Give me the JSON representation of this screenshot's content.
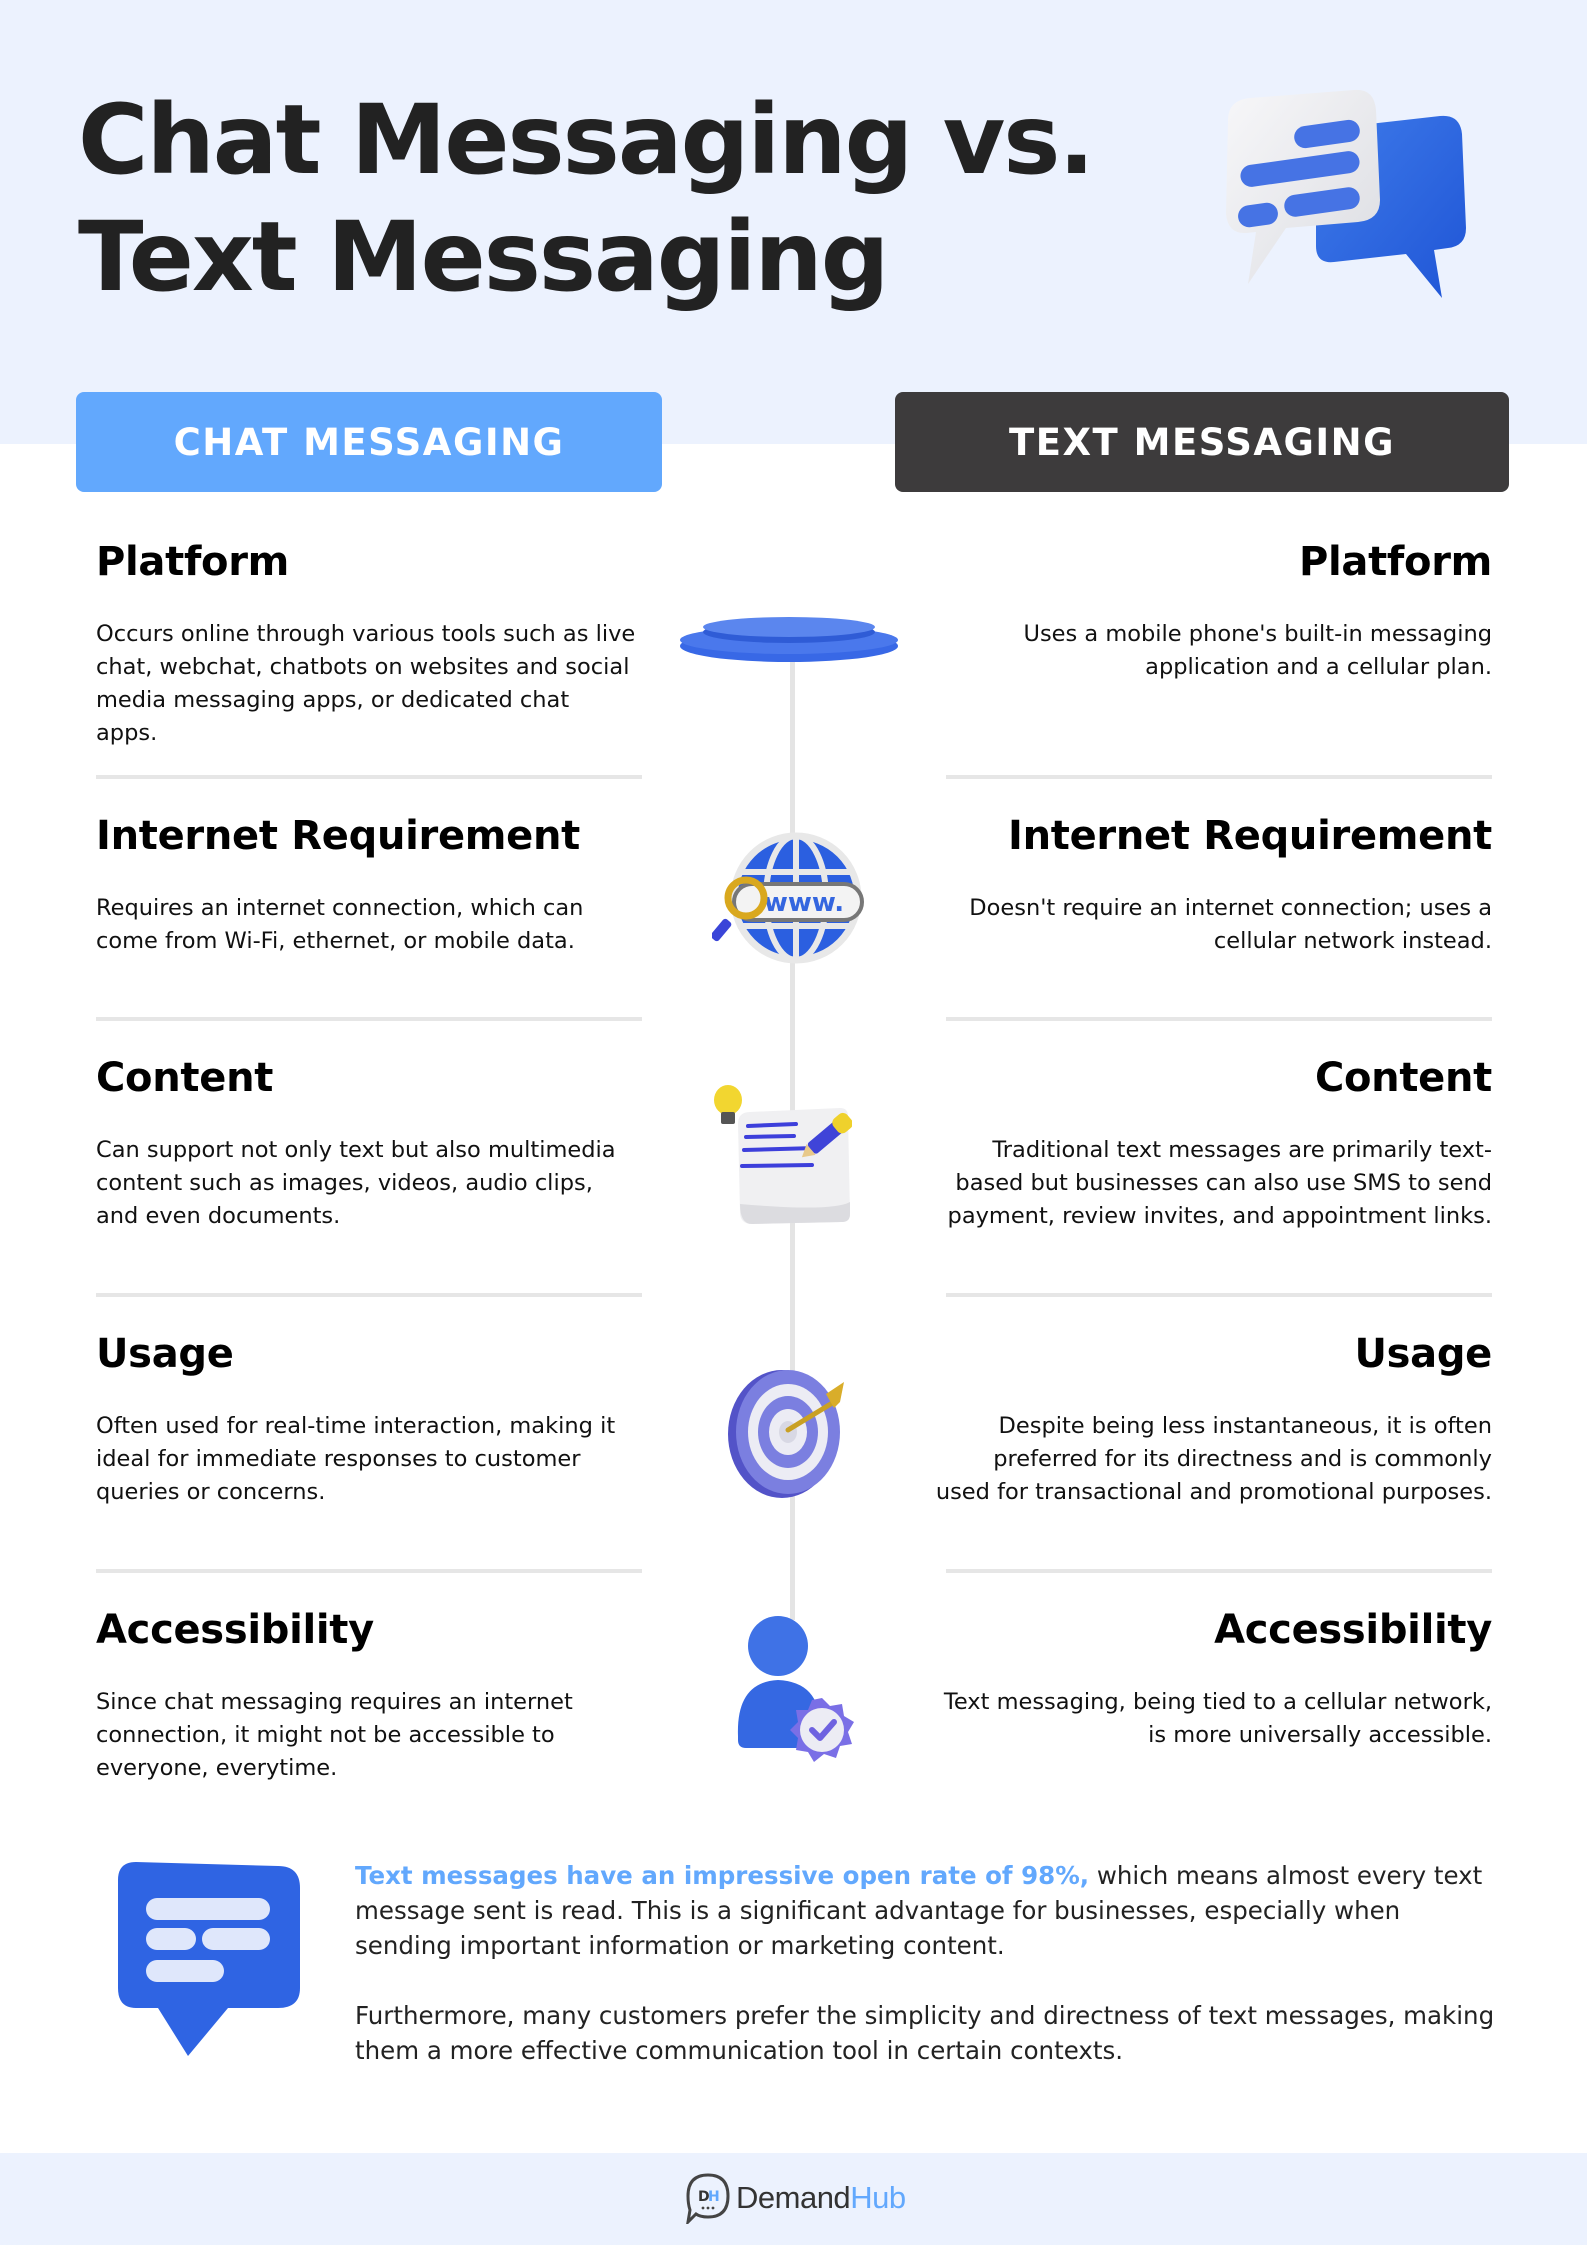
{
  "title": {
    "line1": "Chat Messaging vs.",
    "line2": "Text Messaging"
  },
  "hero_icon": "chat-bubbles-icon",
  "columns": {
    "chat": {
      "label": "CHAT MESSAGING",
      "color": "#62a8fd"
    },
    "text": {
      "label": "TEXT MESSAGING",
      "color": "#3d3b3c"
    }
  },
  "rows": [
    {
      "icon": "platform-disc-icon",
      "chat": {
        "heading": "Platform",
        "body": "Occurs online through various tools such as live chat, webchat, chatbots on websites and social media messaging apps, or dedicated chat apps."
      },
      "text": {
        "heading": "Platform",
        "body": "Uses a mobile phone's built-in messaging application and a cellular plan."
      }
    },
    {
      "icon": "globe-www-icon",
      "chat": {
        "heading": "Internet Requirement",
        "body": "Requires an internet connection, which can come from Wi-Fi, ethernet, or mobile data."
      },
      "text": {
        "heading": "Internet Requirement",
        "body": "Doesn't require an internet connection; uses a cellular network instead."
      }
    },
    {
      "icon": "document-lightbulb-pencil-icon",
      "chat": {
        "heading": "Content",
        "body": "Can support not only text but also multimedia content such as images, videos, audio clips, and even documents."
      },
      "text": {
        "heading": "Content",
        "body": "Traditional text messages are primarily text-based but businesses can also use SMS to send payment, review invites, and appointment links."
      }
    },
    {
      "icon": "target-arrow-icon",
      "chat": {
        "heading": "Usage",
        "body": "Often used for real-time interaction, making it ideal for immediate responses to customer queries or concerns."
      },
      "text": {
        "heading": "Usage",
        "body": "Despite being less instantaneous, it is often preferred for its directness and is commonly used for transactional and promotional purposes."
      }
    },
    {
      "icon": "user-verified-icon",
      "chat": {
        "heading": "Accessibility",
        "body": "Since chat messaging requires an internet connection, it might not be accessible to everyone, everytime."
      },
      "text": {
        "heading": "Accessibility",
        "body": "Text messaging, being tied to a cellular network, is more universally accessible."
      }
    }
  ],
  "summary": {
    "icon": "message-bubble-icon",
    "highlight": "Text messages have an impressive open rate of 98%,",
    "para1_rest": " which means almost every text message sent is read. This is a significant advantage for businesses, especially when sending important information or marketing content.",
    "para2": "Furthermore, many customers prefer the simplicity and directness of text messages, making them a more effective communication tool in certain contexts.",
    "highlight_color": "#62a8fd"
  },
  "footer": {
    "logo_mark": "DH",
    "brand_part1": "Demand",
    "brand_part2": "Hub"
  }
}
